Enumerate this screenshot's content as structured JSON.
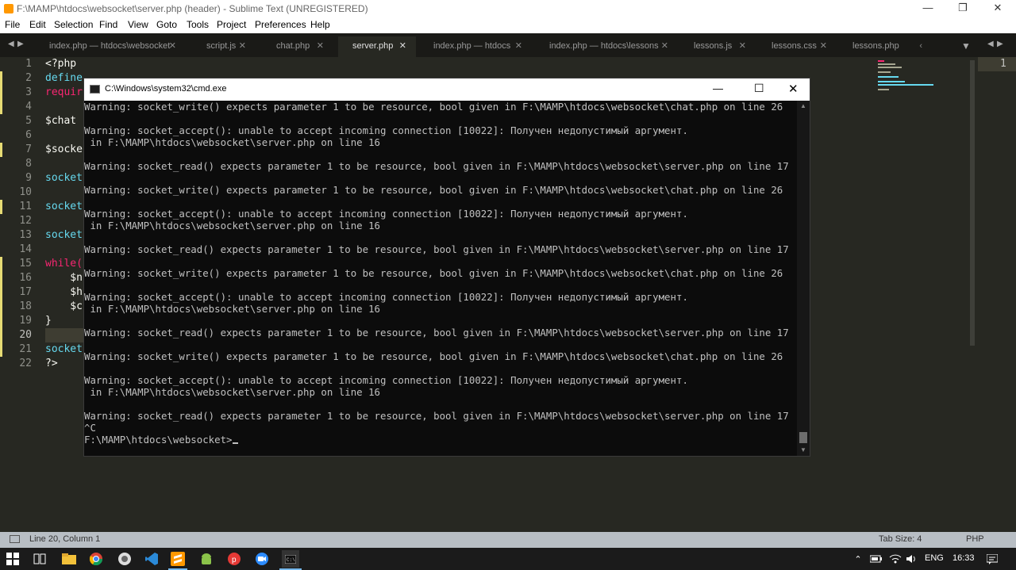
{
  "window": {
    "title": "F:\\MAMP\\htdocs\\websocket\\server.php (header) - Sublime Text (UNREGISTERED)"
  },
  "menu": [
    "File",
    "Edit",
    "Selection",
    "Find",
    "View",
    "Goto",
    "Tools",
    "Project",
    "Preferences",
    "Help"
  ],
  "tabs": [
    {
      "label": "index.php — htdocs\\websocket",
      "active": false
    },
    {
      "label": "script.js",
      "active": false
    },
    {
      "label": "chat.php",
      "active": false
    },
    {
      "label": "server.php",
      "active": true
    },
    {
      "label": "index.php — htdocs",
      "active": false
    },
    {
      "label": "index.php — htdocs\\lessons",
      "active": false
    },
    {
      "label": "lessons.js",
      "active": false
    },
    {
      "label": "lessons.css",
      "active": false
    },
    {
      "label": "lessons.php",
      "active": false
    }
  ],
  "gutter": [
    "1",
    "2",
    "3",
    "4",
    "5",
    "6",
    "7",
    "8",
    "9",
    "10",
    "11",
    "12",
    "13",
    "14",
    "15",
    "16",
    "17",
    "18",
    "19",
    "20",
    "21",
    "22"
  ],
  "code_lines": [
    "<?php",
    "define",
    "requir",
    "",
    "$chat",
    "",
    "$socke",
    "",
    "socket",
    "",
    "socket",
    "",
    "socket",
    "",
    "while(",
    "    $n",
    "    $h",
    "    $c",
    "}",
    "",
    "socket",
    "?>"
  ],
  "right_pane_line": "1",
  "cmd": {
    "title": "C:\\Windows\\system32\\cmd.exe",
    "lines": [
      "Warning: socket_write() expects parameter 1 to be resource, bool given in F:\\MAMP\\htdocs\\websocket\\chat.php on line 26",
      "",
      "Warning: socket_accept(): unable to accept incoming connection [10022]: Получен недопустимый аргумент.",
      " in F:\\MAMP\\htdocs\\websocket\\server.php on line 16",
      "",
      "Warning: socket_read() expects parameter 1 to be resource, bool given in F:\\MAMP\\htdocs\\websocket\\server.php on line 17",
      "",
      "Warning: socket_write() expects parameter 1 to be resource, bool given in F:\\MAMP\\htdocs\\websocket\\chat.php on line 26",
      "",
      "Warning: socket_accept(): unable to accept incoming connection [10022]: Получен недопустимый аргумент.",
      " in F:\\MAMP\\htdocs\\websocket\\server.php on line 16",
      "",
      "Warning: socket_read() expects parameter 1 to be resource, bool given in F:\\MAMP\\htdocs\\websocket\\server.php on line 17",
      "",
      "Warning: socket_write() expects parameter 1 to be resource, bool given in F:\\MAMP\\htdocs\\websocket\\chat.php on line 26",
      "",
      "Warning: socket_accept(): unable to accept incoming connection [10022]: Получен недопустимый аргумент.",
      " in F:\\MAMP\\htdocs\\websocket\\server.php on line 16",
      "",
      "Warning: socket_read() expects parameter 1 to be resource, bool given in F:\\MAMP\\htdocs\\websocket\\server.php on line 17",
      "",
      "Warning: socket_write() expects parameter 1 to be resource, bool given in F:\\MAMP\\htdocs\\websocket\\chat.php on line 26",
      "",
      "Warning: socket_accept(): unable to accept incoming connection [10022]: Получен недопустимый аргумент.",
      " in F:\\MAMP\\htdocs\\websocket\\server.php on line 16",
      "",
      "Warning: socket_read() expects parameter 1 to be resource, bool given in F:\\MAMP\\htdocs\\websocket\\server.php on line 17",
      "^C"
    ],
    "prompt": "F:\\MAMP\\htdocs\\websocket>"
  },
  "status": {
    "position": "Line 20, Column 1",
    "tab_size": "Tab Size: 4",
    "syntax": "PHP"
  },
  "taskbar": {
    "lang": "ENG",
    "time": "16:33"
  },
  "colors": {
    "editor_bg": "#272822",
    "keyword": "#f92672",
    "func": "#66d9ef",
    "text": "#f8f8f2",
    "gutter": "#8f908a",
    "cmd_bg": "#0c0c0c",
    "cmd_text": "#c0c0c0"
  }
}
